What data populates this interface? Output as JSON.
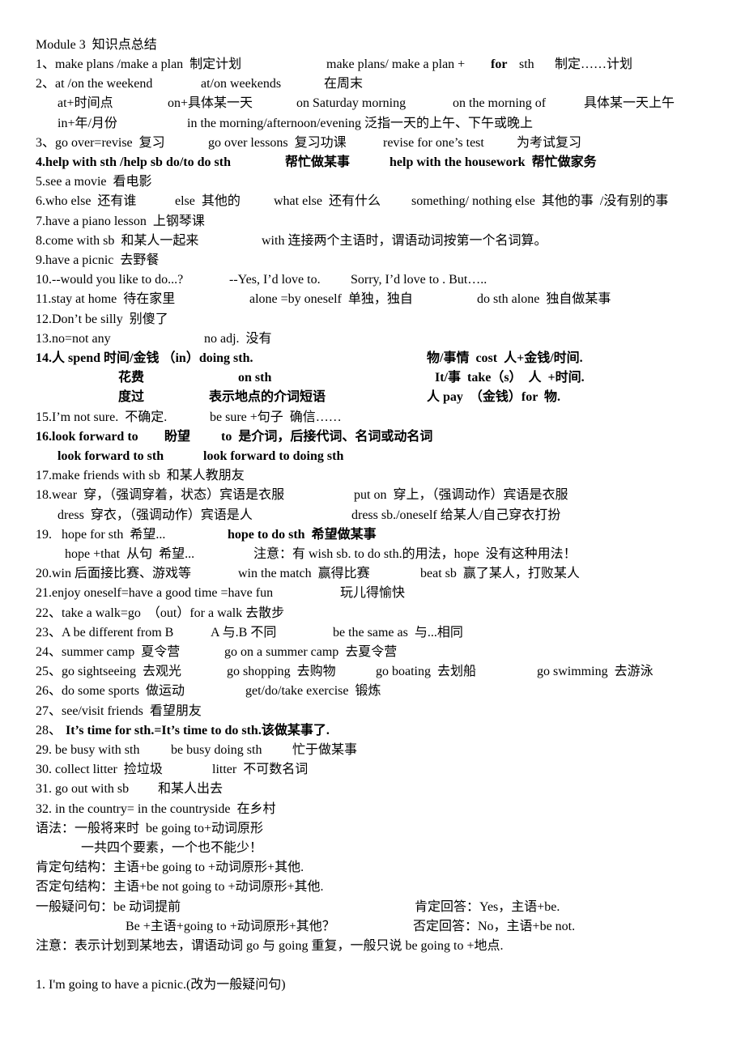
{
  "title": "Module 3  知识点总结",
  "lines": [
    {
      "segs": [
        "1、make plans /make a plan  制定计划",
        "make plans/ make a plan + ",
        "for",
        " sth",
        "制定……计划"
      ]
    },
    {
      "segs": [
        "2、at /on the weekend",
        "at/on weekends",
        "在周末"
      ]
    },
    {
      "segs": [
        "at+时间点",
        "on+具体某一天",
        "on Saturday morning",
        "on the morning of",
        "具体某一天上午"
      ]
    },
    {
      "segs": [
        "in+年/月份",
        "in the morning/afternoon/evening 泛指一天的上午、下午或晚上"
      ]
    },
    {
      "segs": [
        "3、go over=revise  复习",
        "go over lessons  复习功课",
        "revise for one’s test",
        "为考试复习"
      ]
    },
    {
      "segs": [
        "4.help with sth /help sb do/to do sth",
        "帮忙做某事",
        "help with the housework  帮忙做家务"
      ]
    },
    {
      "segs": [
        "5.see a movie  看电影"
      ]
    },
    {
      "segs": [
        "6.who else  还有谁",
        "else  其他的",
        "what else  还有什么",
        "something/ nothing else  其他的事  /没有别的事"
      ]
    },
    {
      "segs": [
        "7.have a piano lesson  上钢琴课"
      ]
    },
    {
      "segs": [
        "8.come with sb  和某人一起来",
        "with 连接两个主语时，谓语动词按第一个名词算。"
      ]
    },
    {
      "segs": [
        "9.have a picnic  去野餐"
      ]
    },
    {
      "segs": [
        "10.--would you like to do...?",
        "--Yes, I’d love to.",
        "Sorry, I’d love to . But….."
      ]
    },
    {
      "segs": [
        "11.stay at home  待在家里",
        "alone =by oneself  单独，独自",
        "do sth alone  独自做某事"
      ]
    },
    {
      "segs": [
        "12.Don’t be silly  别傻了"
      ]
    },
    {
      "segs": [
        "13.no=not any",
        "no adj.  没有"
      ]
    },
    {
      "segs": [
        "14.人 spend 时间/金钱 （in）doing sth.",
        "物/事情  cost  人+金钱/时间."
      ]
    },
    {
      "segs": [
        "花费",
        "on sth",
        "It/事  take（s）  人  +时间."
      ]
    },
    {
      "segs": [
        "度过",
        "表示地点的介词短语",
        "人 pay  （金钱）for  物."
      ]
    },
    {
      "segs": [
        "15.I’m not sure.  不确定.",
        "be sure +句子  确信……"
      ]
    },
    {
      "segs": [
        "16.look forward to",
        "盼望",
        "to  是介词，后接代词、名词或动名词"
      ]
    },
    {
      "segs": [
        "look forward to sth",
        "look forward to doing sth"
      ]
    },
    {
      "segs": [
        "17.make friends with sb  和某人教朋友"
      ]
    },
    {
      "segs": [
        "18.wear  穿，（强调穿着，状态）宾语是衣服",
        "put on  穿上，（强调动作）宾语是衣服"
      ]
    },
    {
      "segs": [
        "dress  穿衣，（强调动作）宾语是人",
        "dress sb./oneself 给某人/自己穿衣打扮"
      ]
    },
    {
      "segs": [
        "19.   hope for sth  希望...",
        "hope to do sth  希望做某事"
      ]
    },
    {
      "segs": [
        "hope +that  从句  希望...",
        "注意：有 wish sb. to do sth.的用法，hope  没有这种用法！"
      ]
    },
    {
      "segs": [
        "20.win 后面接比赛、游戏等",
        "win the match  赢得比赛",
        "beat sb  赢了某人，打败某人"
      ]
    },
    {
      "segs": [
        "21.enjoy oneself=have a good time =have fun",
        "玩儿得愉快"
      ]
    },
    {
      "segs": [
        "22、take a walk=go  （out）for a walk 去散步"
      ]
    },
    {
      "segs": [
        "23、A be different from B",
        "A 与.B 不同",
        "be the same as  与...相同"
      ]
    },
    {
      "segs": [
        "24、summer camp  夏令营",
        "go on a summer camp  去夏令营"
      ]
    },
    {
      "segs": [
        "25、go sightseeing  去观光",
        "go shopping  去购物",
        "go boating  去划船",
        "go swimming  去游泳"
      ]
    },
    {
      "segs": [
        "26、do some sports  做运动",
        "get/do/take exercise  锻炼"
      ]
    },
    {
      "segs": [
        "27、see/visit friends  看望朋友"
      ]
    },
    {
      "segs": [
        "28、",
        "It’s time for sth.=It’s time to do sth.该做某事了."
      ]
    },
    {
      "segs": [
        "29. be busy with sth",
        "be busy doing sth",
        "忙于做某事"
      ]
    },
    {
      "segs": [
        "30. collect litter  捡垃圾",
        "litter  不可数名词"
      ]
    },
    {
      "segs": [
        "31. go out with sb",
        "和某人出去"
      ]
    },
    {
      "segs": [
        "32. in the country= in the countryside  在乡村"
      ]
    },
    {
      "segs": [
        "语法：一般将来时  be going to+动词原形"
      ]
    },
    {
      "segs": [
        "一共四个要素，一个也不能少！"
      ]
    },
    {
      "segs": [
        "肯定句结构：主语+be going to +动词原形+其他."
      ]
    },
    {
      "segs": [
        "否定句结构：主语+be not going to +动词原形+其他."
      ]
    },
    {
      "segs": [
        "一般疑问句：be 动词提前",
        "肯定回答：Yes，主语+be."
      ]
    },
    {
      "segs": [
        "Be +主语+going to +动词原形+其他？",
        "否定回答：No，主语+be not."
      ]
    },
    {
      "segs": [
        "注意：表示计划到某地去，谓语动词 go 与 going 重复，一般只说 be going to +地点."
      ]
    },
    {
      "segs": []
    },
    {
      "segs": [
        "1. I'm going to have a picnic.(改为一般疑问句)"
      ]
    }
  ]
}
